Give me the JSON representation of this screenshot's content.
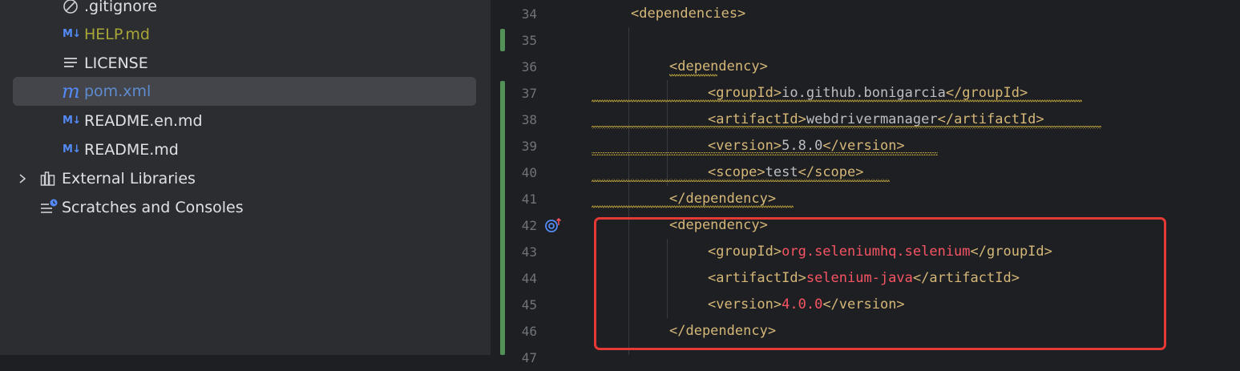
{
  "project_tree": {
    "items": [
      {
        "label": ".gitignore",
        "icon": "ignored-file-icon",
        "color": "#dfe1e5"
      },
      {
        "label": "HELP.md",
        "icon": "markdown-icon",
        "color": "#a8a637"
      },
      {
        "label": "LICENSE",
        "icon": "text-file-icon",
        "color": "#dfe1e5"
      },
      {
        "label": "pom.xml",
        "icon": "maven-icon",
        "color": "#5e8ccf",
        "selected": true
      },
      {
        "label": "README.en.md",
        "icon": "markdown-icon",
        "color": "#dfe1e5"
      },
      {
        "label": "README.md",
        "icon": "markdown-icon",
        "color": "#dfe1e5"
      },
      {
        "label": "External Libraries",
        "icon": "library-icon",
        "color": "#dfe1e5",
        "expandable": true
      },
      {
        "label": "Scratches and Consoles",
        "icon": "scratches-icon",
        "color": "#dfe1e5"
      }
    ],
    "markdown_badge": "M↓"
  },
  "editor": {
    "line_numbers": [
      "34",
      "35",
      "36",
      "37",
      "38",
      "39",
      "40",
      "41",
      "42",
      "43",
      "44",
      "45",
      "46",
      "47"
    ],
    "lines": {
      "l34": {
        "open": "<dependencies>"
      },
      "l36": {
        "open": "<dependency>"
      },
      "l37": {
        "open": "<groupId>",
        "value": "io.github.bonigarcia",
        "close": "</groupId>"
      },
      "l38": {
        "open": "<artifactId>",
        "value": "webdrivermanager",
        "close": "</artifactId>"
      },
      "l39": {
        "open": "<version>",
        "value": "5.8.0",
        "close": "</version>"
      },
      "l40": {
        "open": "<scope>",
        "value": "test",
        "close": "</scope>"
      },
      "l41": {
        "close": "</dependency>"
      },
      "l42": {
        "open": "<dependency>"
      },
      "l43": {
        "open": "<groupId>",
        "value": "org.seleniumhq.selenium",
        "close": "</groupId>"
      },
      "l44": {
        "open": "<artifactId>",
        "value": "selenium-java",
        "close": "</artifactId>"
      },
      "l45": {
        "open": "<version>",
        "value": "4.0.0",
        "close": "</version>"
      },
      "l46": {
        "close": "</dependency>"
      }
    }
  },
  "colors": {
    "tag": "#d5b778",
    "text": "#bcbec4",
    "highlight_value": "#f75464",
    "highlight_box": "#e53935",
    "vcs_added": "#549159"
  }
}
